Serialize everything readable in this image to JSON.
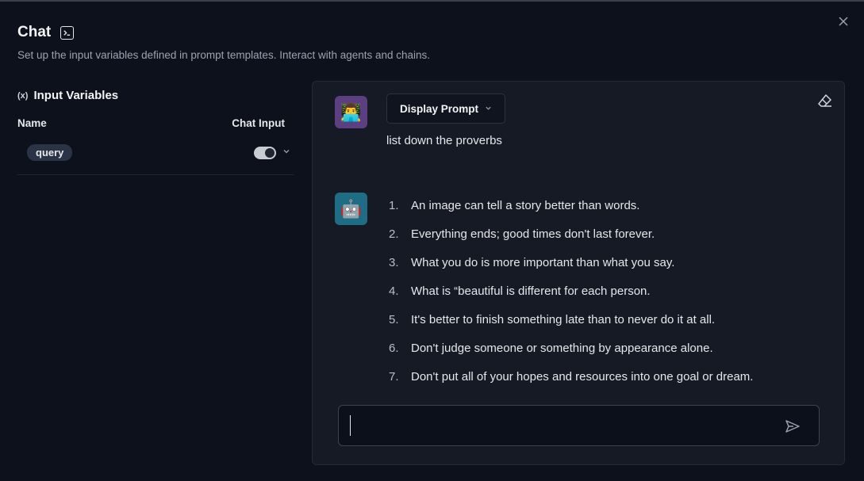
{
  "header": {
    "title": "Chat",
    "subtitle": "Set up the input variables defined in prompt templates. Interact with agents and chains."
  },
  "left": {
    "section_title": "Input Variables",
    "section_icon": "(x)",
    "col_name": "Name",
    "col_chat_input": "Chat Input",
    "variables": [
      {
        "name": "query",
        "chat_input": true
      }
    ]
  },
  "chat": {
    "display_prompt_label": "Display Prompt",
    "user_message": "list down the proverbs",
    "user_avatar": "👨‍💻",
    "bot_avatar": "🤖",
    "answer_items": [
      {
        "num": "1.",
        "text": "An image can tell a story better than words."
      },
      {
        "num": "2.",
        "text": "Everything ends; good times don't last forever."
      },
      {
        "num": "3.",
        "text": "What you do is more important than what you say."
      },
      {
        "num": "4.",
        "text": "What is “beautiful is different for each person."
      },
      {
        "num": "5.",
        "text": "It's better to finish something late than to never do it at all."
      },
      {
        "num": "6.",
        "text": "Don't judge someone or something by appearance alone."
      },
      {
        "num": "7.",
        "text": "Don't put all of your hopes and resources into one goal or dream."
      }
    ],
    "input_value": "",
    "input_placeholder": ""
  },
  "colors": {
    "background": "#0c111c",
    "panel": "#151a25",
    "user_avatar_bg": "#5b3f80",
    "bot_avatar_bg": "#1f6d84"
  }
}
